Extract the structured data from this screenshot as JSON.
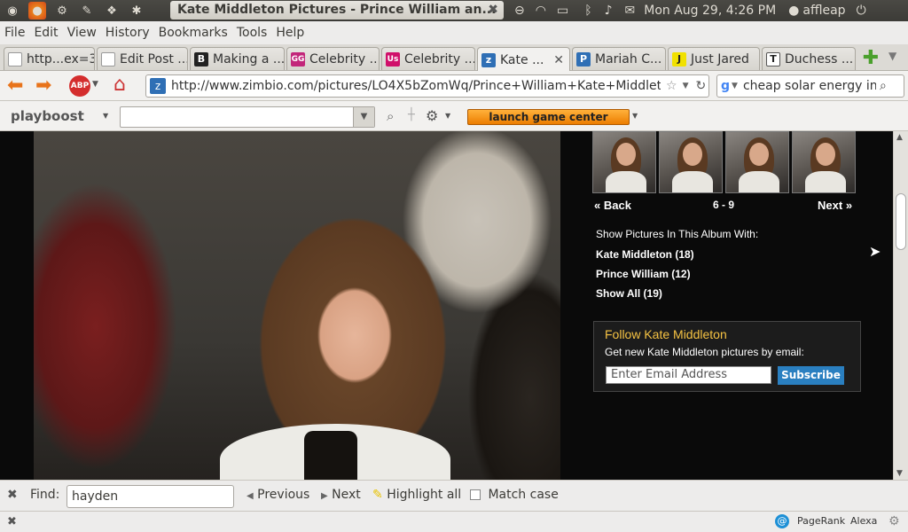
{
  "window": {
    "title": "Kate Middleton Pictures - Prince William an..."
  },
  "panel": {
    "clock": "Mon Aug 29,  4:26 PM",
    "user": "affleap"
  },
  "menu": [
    "File",
    "Edit",
    "View",
    "History",
    "Bookmarks",
    "Tools",
    "Help"
  ],
  "tabs": [
    {
      "label": "http...ex=3",
      "icon_bg": "#ffffff",
      "icon_text": ""
    },
    {
      "label": "Edit Post ...",
      "icon_bg": "#ffffff",
      "icon_text": ""
    },
    {
      "label": "Making a ...",
      "icon_bg": "#222222",
      "icon_text": "B"
    },
    {
      "label": "Celebrity ...",
      "icon_bg": "#c2267a",
      "icon_text": "GG"
    },
    {
      "label": "Celebrity ...",
      "icon_bg": "#d0106a",
      "icon_text": "Us"
    },
    {
      "label": "Kate ...",
      "icon_bg": "#2f6fb5",
      "icon_text": "z"
    },
    {
      "label": "Mariah C...",
      "icon_bg": "#2f6fb5",
      "icon_text": "P"
    },
    {
      "label": "Just Jared",
      "icon_bg": "#f1e100",
      "icon_text": "J"
    },
    {
      "label": "Duchess ...",
      "icon_bg": "#ffffff",
      "icon_text": "T"
    }
  ],
  "nav": {
    "url": "http://www.zimbio.com/pictures/LO4X5bZomWq/Prince+William+Kate+Middleton+",
    "search_value": "cheap solar energy in p"
  },
  "toolbar2": {
    "brand": "playboost",
    "launch_label": "launch game center"
  },
  "gallery": {
    "back_label": "Back",
    "range": "6 - 9",
    "next_label": "Next",
    "show_with_label": "Show Pictures In This Album With:",
    "filters": [
      "Kate Middleton (18)",
      "Prince William (12)",
      "Show All (19)"
    ]
  },
  "follow": {
    "title": "Follow Kate Middleton",
    "subtitle": "Get new Kate Middleton pictures by email:",
    "email_placeholder": "Enter Email Address",
    "subscribe_label": "Subscribe"
  },
  "findbar": {
    "label": "Find:",
    "value": "hayden",
    "previous": "Previous",
    "next": "Next",
    "highlight": "Highlight all",
    "match_case": "Match case"
  },
  "statusbar": {
    "pagerank": "PageRank",
    "alexa": "Alexa"
  }
}
